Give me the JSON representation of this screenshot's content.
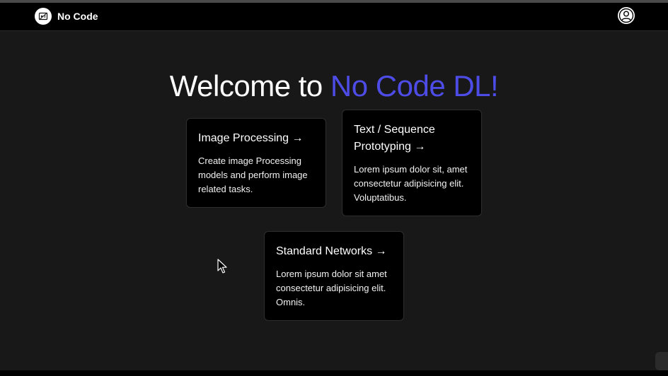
{
  "navbar": {
    "brand_label": "No Code",
    "logo_icon": "no-code-logo-icon",
    "user_icon": "user-profile-icon"
  },
  "hero": {
    "prefix": "Welcome to ",
    "highlight": "No Code DL!",
    "highlight_color": "#4d4ce6"
  },
  "cards": [
    {
      "title": "Image Processing →",
      "description": "Create image Processing models and perform image related tasks."
    },
    {
      "title": "Text / Sequence Prototyping →",
      "description": "Lorem ipsum dolor sit, amet consectetur adipisicing elit. Voluptatibus."
    },
    {
      "title": "Standard Networks →",
      "description": "Lorem ipsum dolor sit amet consectetur adipisicing elit. Omnis."
    }
  ],
  "colors": {
    "background": "#181818",
    "navbar": "#000000",
    "card": "#000000",
    "accent": "#4d4ce6"
  }
}
